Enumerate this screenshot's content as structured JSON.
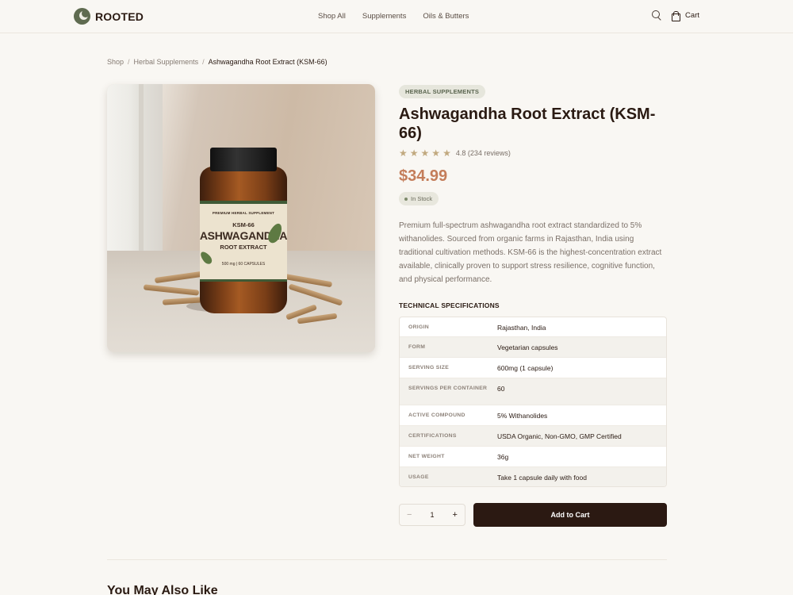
{
  "brand": {
    "name": "ROOTED"
  },
  "nav": {
    "items": [
      {
        "label": "Shop All"
      },
      {
        "label": "Supplements"
      },
      {
        "label": "Oils & Butters"
      }
    ],
    "cart_label": "Cart"
  },
  "breadcrumb": {
    "items": [
      "Shop",
      "Herbal Supplements"
    ],
    "current": "Ashwagandha Root Extract (KSM-66)",
    "separator": "/"
  },
  "product": {
    "category_badge": "HERBAL SUPPLEMENTS",
    "title": "Ashwagandha Root Extract (KSM-66)",
    "rating": {
      "stars": 5,
      "text": "4.8 (234 reviews)"
    },
    "price": "$34.99",
    "stock_status": "In Stock",
    "description": "Premium full-spectrum ashwagandha root extract standardized to 5% withanolides. Sourced from organic farms in Rajasthan, India using traditional cultivation methods. KSM-66 is the highest-concentration extract available, clinically proven to support stress resilience, cognitive function, and physical performance.",
    "image_label": {
      "top": "PREMIUM HERBAL SUPPLEMENT",
      "ksm": "KSM-66",
      "name": "ASHWAGANDHA",
      "sub": "ROOT EXTRACT",
      "dose": "500 mg | 60 CAPSULES"
    }
  },
  "specs": {
    "heading": "TECHNICAL SPECIFICATIONS",
    "rows": [
      {
        "key": "ORIGIN",
        "value": "Rajasthan, India"
      },
      {
        "key": "FORM",
        "value": "Vegetarian capsules"
      },
      {
        "key": "SERVING SIZE",
        "value": "600mg (1 capsule)"
      },
      {
        "key": "SERVINGS PER CONTAINER",
        "value": "60"
      },
      {
        "key": "ACTIVE COMPOUND",
        "value": "5% Withanolides"
      },
      {
        "key": "CERTIFICATIONS",
        "value": "USDA Organic, Non-GMO, GMP Certified"
      },
      {
        "key": "NET WEIGHT",
        "value": "36g"
      },
      {
        "key": "USAGE",
        "value": "Take 1 capsule daily with food"
      }
    ]
  },
  "purchase": {
    "quantity": "1",
    "minus": "−",
    "plus": "+",
    "add_to_cart": "Add to Cart"
  },
  "related": {
    "title": "You May Also Like"
  },
  "colors": {
    "background": "#f9f7f3",
    "primary_dark": "#2b1912",
    "price": "#c47d5a",
    "star": "#c1a97f",
    "brand_green": "#5f6b50"
  }
}
